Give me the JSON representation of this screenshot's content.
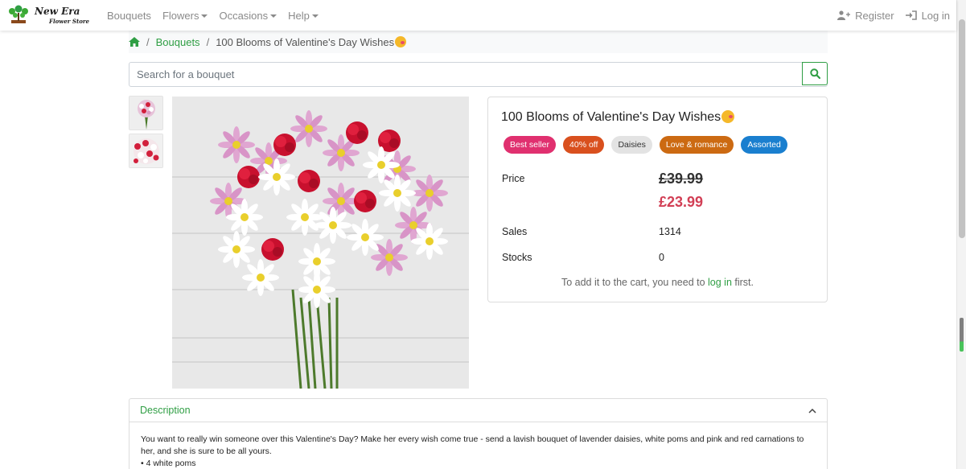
{
  "navbar": {
    "brand_name": "New Era",
    "brand_sub": "Flower Store",
    "links": [
      {
        "label": "Bouquets",
        "dropdown": false
      },
      {
        "label": "Flowers",
        "dropdown": true
      },
      {
        "label": "Occasions",
        "dropdown": true
      },
      {
        "label": "Help",
        "dropdown": true
      }
    ],
    "register_label": "Register",
    "login_label": "Log in"
  },
  "breadcrumb": {
    "home_icon": "home-icon",
    "items": [
      "Bouquets",
      "100 Blooms of Valentine's Day Wishes"
    ]
  },
  "search": {
    "placeholder": "Search for a bouquet",
    "value": "",
    "icon": "search-icon"
  },
  "product": {
    "title": "100 Blooms of Valentine's Day Wishes",
    "thumbnails": 2,
    "badges": [
      {
        "label": "Best seller",
        "color": "#e0306f"
      },
      {
        "label": "40% off",
        "color": "#d9501e"
      },
      {
        "label": "Daisies",
        "color": "#e3e3e3"
      },
      {
        "label": "Love & romance",
        "color": "#cc6a12"
      },
      {
        "label": "Assorted",
        "color": "#1a7fcf"
      }
    ],
    "price_label": "Price",
    "price_old": "£39.99",
    "price_new": "£23.99",
    "sales_label": "Sales",
    "sales_value": "1314",
    "stocks_label": "Stocks",
    "stocks_value": "0",
    "cart_note_before": "To add it to the cart, you need to ",
    "cart_note_link": "log in",
    "cart_note_after": " first."
  },
  "description": {
    "title": "Description",
    "text": "You want to really win someone over this Valentine's Day? Make her every wish come true - send a lavish bouquet of lavender daisies, white poms and pink and red carnations to her, and she is sure to be all yours.",
    "list": [
      "4 white poms"
    ]
  },
  "colors": {
    "accent": "#2f9e44",
    "sale_price": "#d23f55"
  }
}
